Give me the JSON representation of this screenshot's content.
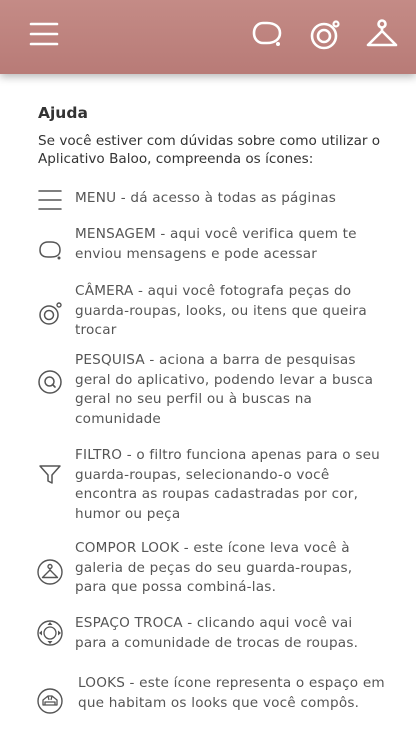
{
  "header": {
    "menu_icon": "menu-icon",
    "message_icon": "message-icon",
    "camera_icon": "camera-icon",
    "profile_icon": "hanger-icon",
    "background_color": "#b87b77"
  },
  "help": {
    "title": "Ajuda",
    "intro": "Se você estiver com dúvidas sobre como utilizar o Aplicativo Baloo, compreenda os ícones:",
    "items": [
      {
        "icon": "menu-icon",
        "text": "MENU - dá acesso à todas as páginas"
      },
      {
        "icon": "message-icon",
        "text": "MENSAGEM - aqui você verifica quem te enviou mensagens e pode acessar"
      },
      {
        "icon": "camera-icon",
        "text": "CÂMERA - aqui você fotografa peças do guarda-roupas, looks, ou itens que queira trocar"
      },
      {
        "icon": "search-icon",
        "text": "PESQUISA - aciona a barra de pesquisas geral do aplicativo, podendo levar a busca geral no seu perfil ou à buscas na comunidade"
      },
      {
        "icon": "filter-icon",
        "text": "FILTRO - o filtro funciona apenas para o seu guarda-roupas, selecionando-o você encontra as roupas cadastradas por cor, humor ou peça"
      },
      {
        "icon": "hanger-circle-icon",
        "text": "COMPOR LOOK - este ícone leva você à galeria de peças do seu guarda-roupas, para que possa combiná-las."
      },
      {
        "icon": "exchange-icon",
        "text": "ESPAÇO TROCA - clicando aqui você vai para a comunidade de trocas de roupas."
      },
      {
        "icon": "looks-icon",
        "text": "LOOKS - este ícone representa o espaço em que habitam os looks que você compôs."
      }
    ]
  }
}
